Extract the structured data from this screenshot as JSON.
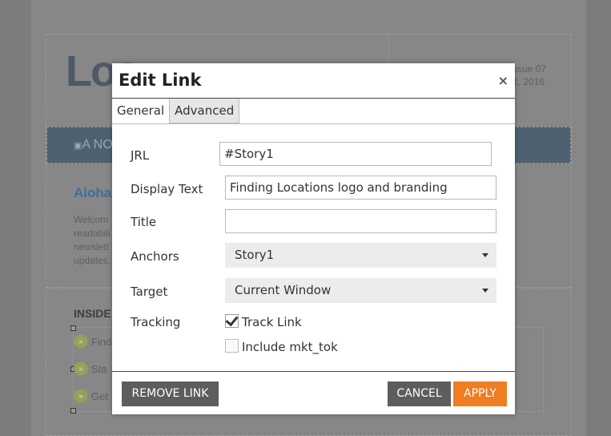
{
  "background": {
    "logo_text": "Loc",
    "issue_lines": [
      "ssue 07",
      "1, 2016"
    ],
    "banner_text": "A NO",
    "greeting": "Aloha",
    "welcome_lines": [
      "Welcom",
      "readabili",
      "newslett",
      "updates."
    ],
    "inside_heading": "INSIDE",
    "list_items": [
      "Find",
      "Sta",
      "Get"
    ]
  },
  "dialog": {
    "title": "Edit Link",
    "close_glyph": "×",
    "tabs": [
      {
        "label": "General",
        "active": true
      },
      {
        "label": "Advanced",
        "active": false
      }
    ],
    "fields": {
      "url_label": "JRL",
      "url_value": "#Story1",
      "display_text_label": "Display Text",
      "display_text_value": "Finding Locations logo and branding",
      "title_label": "Title",
      "title_value": "",
      "anchors_label": "Anchors",
      "anchors_value": "Story1",
      "target_label": "Target",
      "target_value": "Current Window",
      "tracking_label": "Tracking",
      "track_link_label": "Track Link",
      "track_link_checked": true,
      "include_mkt_tok_label": "Include mkt_tok",
      "include_mkt_tok_checked": false
    },
    "buttons": {
      "remove_link": "REMOVE LINK",
      "cancel": "CANCEL",
      "apply": "APPLY"
    }
  },
  "colors": {
    "accent": "#ef7d22",
    "button_grey": "#5d5d5d",
    "overlay": "#7c7c7c"
  }
}
